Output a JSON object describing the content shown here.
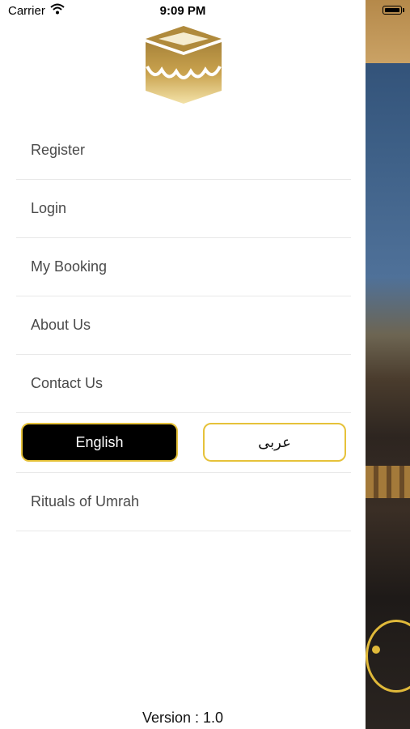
{
  "status_bar": {
    "carrier": "Carrier",
    "time": "9:09 PM"
  },
  "menu": {
    "items": [
      "Register",
      "Login",
      "My Booking",
      "About Us",
      "Contact Us"
    ],
    "language": {
      "english": "English",
      "arabic": "عربى",
      "selected": "English"
    },
    "rituals": "Rituals of Umrah"
  },
  "footer": {
    "version": "Version : 1.0"
  },
  "colors": {
    "gold_accent": "#e6c23a",
    "selected_language_bg": "#000000"
  }
}
